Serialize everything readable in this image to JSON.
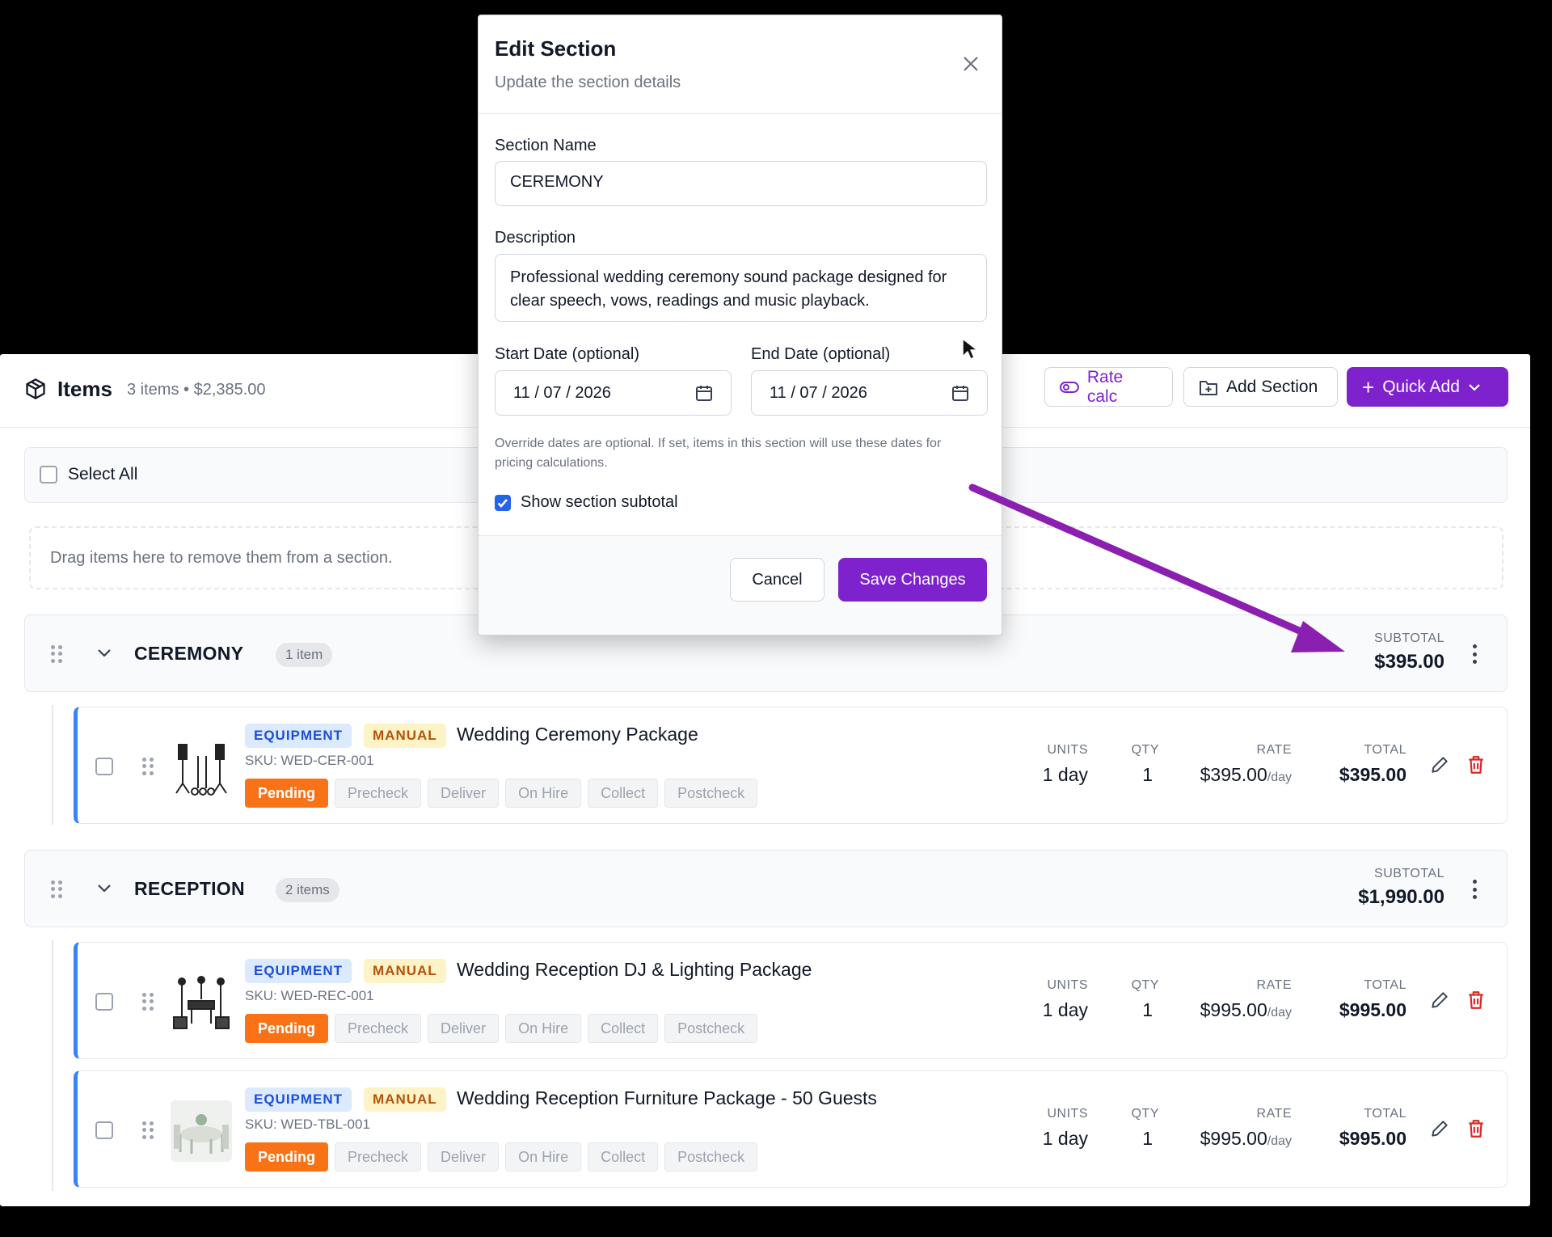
{
  "header": {
    "title": "Items",
    "meta": "3 items • $2,385.00",
    "rate_calc": "Rate calc",
    "add_section": "Add Section",
    "quick_add": "Quick Add"
  },
  "select_all": "Select All",
  "dropzone": "Drag items here to remove them from a section.",
  "column_labels": {
    "units": "UNITS",
    "qty": "QTY",
    "rate": "RATE",
    "total": "TOTAL",
    "subtotal": "SUBTOTAL",
    "per_day": "/day"
  },
  "tags": {
    "equipment": "EQUIPMENT",
    "manual": "MANUAL"
  },
  "statuses": [
    "Pending",
    "Precheck",
    "Deliver",
    "On Hire",
    "Collect",
    "Postcheck"
  ],
  "sections": [
    {
      "name": "CEREMONY",
      "count": "1 item",
      "subtotal": "$395.00",
      "items": [
        {
          "name": "Wedding Ceremony Package",
          "sku": "SKU: WED-CER-001",
          "units": "1 day",
          "qty": "1",
          "rate": "$395.00",
          "total": "$395.00"
        }
      ]
    },
    {
      "name": "RECEPTION",
      "count": "2 items",
      "subtotal": "$1,990.00",
      "items": [
        {
          "name": "Wedding Reception DJ & Lighting Package",
          "sku": "SKU: WED-REC-001",
          "units": "1 day",
          "qty": "1",
          "rate": "$995.00",
          "total": "$995.00"
        },
        {
          "name": "Wedding Reception Furniture Package - 50 Guests",
          "sku": "SKU: WED-TBL-001",
          "units": "1 day",
          "qty": "1",
          "rate": "$995.00",
          "total": "$995.00"
        }
      ]
    }
  ],
  "modal": {
    "title": "Edit Section",
    "subtitle": "Update the section details",
    "name_label": "Section Name",
    "name_value": "CEREMONY",
    "description_label": "Description",
    "description_value": "Professional wedding ceremony sound package designed for clear speech, vows, readings and music playback.",
    "start_label": "Start Date (optional)",
    "start_value": "11 / 07 / 2026",
    "end_label": "End Date (optional)",
    "end_value": "11 / 07 / 2026",
    "help": "Override dates are optional. If set, items in this section will use these dates for pricing calculations.",
    "show_subtotal_label": "Show section subtotal",
    "show_subtotal": true,
    "cancel": "Cancel",
    "save": "Save Changes"
  },
  "colors": {
    "accent": "#7e22ce",
    "pending": "#f97316",
    "item_border": "#3b82f6",
    "annotation_arrow": "#8b1fb0"
  }
}
